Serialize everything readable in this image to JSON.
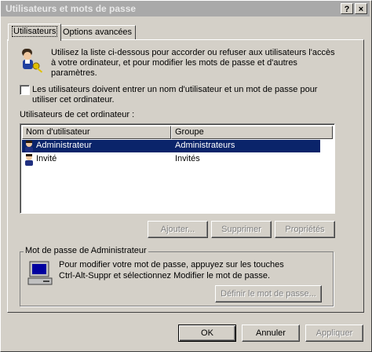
{
  "window": {
    "title": "Utilisateurs et mots de passe",
    "help_label": "?",
    "close_label": "×"
  },
  "tabs": [
    {
      "label": "Utilisateurs",
      "active": true
    },
    {
      "label": "Options avancées",
      "active": false
    }
  ],
  "intro": {
    "line1": "Utilisez la liste ci-dessous pour accorder ou refuser aux utilisateurs l'accès",
    "line2": "à votre ordinateur, et pour modifier les mots de passe et d'autres",
    "line3": "paramètres."
  },
  "require_login": {
    "checked": false,
    "line1": "Les utilisateurs doivent entrer un nom d'utilisateur et un mot de passe pour",
    "line2": "utiliser cet ordinateur."
  },
  "users_list": {
    "label": "Utilisateurs de cet ordinateur :",
    "columns": [
      "Nom d'utilisateur",
      "Groupe"
    ],
    "rows": [
      {
        "name": "Administrateur",
        "group": "Administrateurs",
        "selected": true
      },
      {
        "name": "Invité",
        "group": "Invités",
        "selected": false
      }
    ]
  },
  "list_buttons": {
    "add": "Ajouter...",
    "remove": "Supprimer",
    "properties": "Propriétés"
  },
  "password_group": {
    "title": "Mot de passe de Administrateur",
    "line1": "Pour modifier votre mot de passe, appuyez sur les touches",
    "line2": "Ctrl-Alt-Suppr et sélectionnez Modifier le mot de passe.",
    "set_password": "Définir le mot de passe..."
  },
  "dialog_buttons": {
    "ok": "OK",
    "cancel": "Annuler",
    "apply": "Appliquer"
  },
  "colors": {
    "title_bar": "#a9a9a9",
    "selection": "#0a246a",
    "face": "#d4d0c8"
  }
}
